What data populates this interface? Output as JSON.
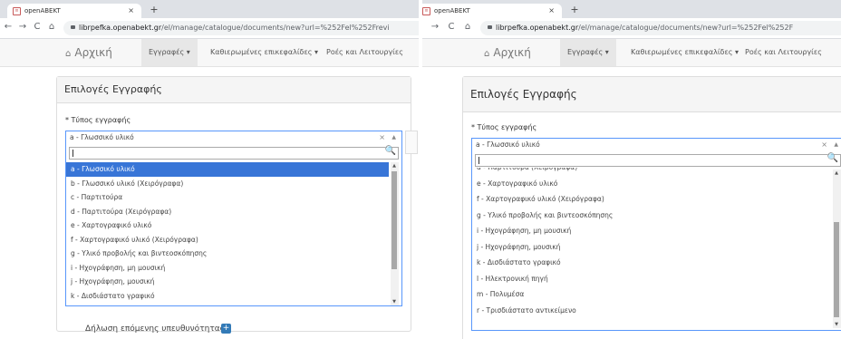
{
  "browser": {
    "tab_title": "openABEKT",
    "tab_close": "×",
    "new_tab": "+",
    "favicon": "≡",
    "url_host": "librpefka.openabekt.gr",
    "url_path_left": "/el/manage/catalogue/documents/new?url=%252Fel%252Frevi",
    "url_path_right": "/el/manage/catalogue/documents/new?url=%252Fel%252F"
  },
  "menu": {
    "home": "Αρχική",
    "home_icon": "⌂",
    "records": "Εγγραφές ▾",
    "headings": "Καθιερωμένες επικεφαλίδες ▾",
    "workflows": "Ροές και Λειτουργίες"
  },
  "form": {
    "title": "Επιλογές Εγγραφής",
    "field_label": "* Τύπος εγγραφής",
    "selected_value": "a - Γλωσσικό υλικό",
    "clear": "×",
    "caret_up": "▲",
    "search_icon": "🔍",
    "search_value": "",
    "declaration": "Δήλωση επόμενης υπευθυνότητας",
    "plus": "+"
  },
  "options_left": [
    "a - Γλωσσικό υλικό",
    "b - Γλωσσικό υλικό (Χειρόγραφα)",
    "c - Παρτιτούρα",
    "d - Παρτιτούρα (Χειρόγραφα)",
    "e - Χαρτογραφικό υλικό",
    "f - Χαρτογραφικό υλικό (Χειρόγραφα)",
    "g - Υλικό προβολής και βιντεοσκόπησης",
    "i - Ηχογράφηση, μη μουσική",
    "j - Ηχογράφηση, μουσική",
    "k - Δισδιάστατο γραφικό"
  ],
  "options_right": [
    "d - Παρτιτούρα (Χειρόγραφα)",
    "e - Χαρτογραφικό υλικό",
    "f - Χαρτογραφικό υλικό (Χειρόγραφα)",
    "g - Υλικό προβολής και βιντεοσκόπησης",
    "i - Ηχογράφηση, μη μουσική",
    "j - Ηχογράφηση, μουσική",
    "k - Δισδιάστατο γραφικό",
    "l - Ηλεκτρονική πηγή",
    "m - Πολυμέσα",
    "r - Τρισδιάστατο αντικείμενο"
  ]
}
